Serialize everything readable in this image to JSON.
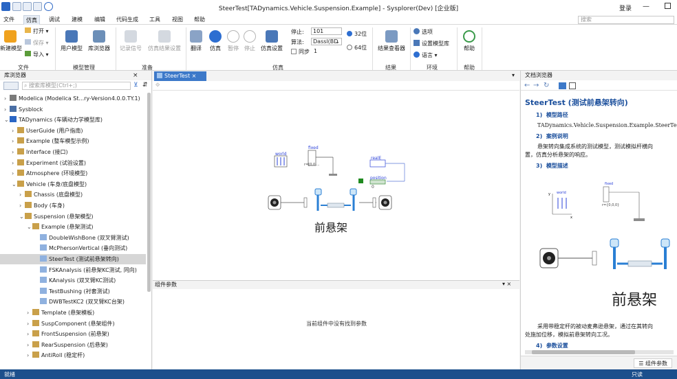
{
  "app": {
    "title": "SteerTest[TADynamics.Vehicle.Suspension.Example] - Sysplorer(Dev) [企业版]",
    "login": "登录"
  },
  "menu": [
    "文件",
    "仿真",
    "调试",
    "建模",
    "编辑",
    "代码生成",
    "工具",
    "视图",
    "帮助"
  ],
  "search": {
    "placeholder": "搜索"
  },
  "ribbon": {
    "new_model": "新建模型",
    "open": "打开",
    "save": "保存",
    "import": "导入",
    "user_model": "用户模型",
    "library_browser": "库浏览器",
    "record_signal": "记录信号",
    "sim_result_settings": "仿真结果设置",
    "translate": "翻译",
    "simulate": "仿真",
    "pause": "暂停",
    "stop": "停止",
    "sim_settings": "仿真设置",
    "stop_time_label": "停止:",
    "stop_time_value": "101",
    "algorithm_label": "算法:",
    "algorithm_value": "Dassl(BD",
    "sync_label": "同步",
    "sync_value": "1",
    "bit32": "32位",
    "bit64": "64位",
    "result_viewer": "结果查看器",
    "options": "选项",
    "set_model_lib": "设置模型库",
    "language": "语言",
    "help": "帮助",
    "groups": {
      "file": "文件",
      "model_mgmt": "模型管理",
      "prepare": "准备",
      "simulation": "仿真",
      "results": "结果",
      "env": "环境",
      "help": "帮助"
    }
  },
  "library": {
    "title": "库浏览器",
    "search_placeholder": "搜索库模型(Ctrl+;)",
    "items": [
      {
        "label": "Modelica (Modelica St...ry-Version4.0.0.TY.1)",
        "arrow": "›"
      },
      {
        "label": "Sysblock",
        "arrow": "›"
      },
      {
        "label": "TADynamics (车辆动力学模型库)",
        "arrow": "⌄"
      },
      {
        "label": "UserGuide (用户指南)",
        "arrow": "›"
      },
      {
        "label": "Example (整车模型示例)",
        "arrow": "›"
      },
      {
        "label": "Interface (接口)",
        "arrow": "›"
      },
      {
        "label": "Experiment (试验设置)",
        "arrow": "›"
      },
      {
        "label": "Atmosphere (环境模型)",
        "arrow": "›"
      },
      {
        "label": "Vehicle (车身/底盘模型)",
        "arrow": "⌄"
      },
      {
        "label": "Chassis (底盘模型)",
        "arrow": "›"
      },
      {
        "label": "Body (车身)",
        "arrow": "›"
      },
      {
        "label": "Suspension (悬架模型)",
        "arrow": "⌄"
      },
      {
        "label": "Example (悬架测试)",
        "arrow": "⌄"
      },
      {
        "label": "DoubleWishBone (双叉臂测试)",
        "arrow": ""
      },
      {
        "label": "McPhersonVertical (垂向测试)",
        "arrow": ""
      },
      {
        "label": "SteerTest (测试前悬架转向)",
        "arrow": ""
      },
      {
        "label": "FSKAnalysis (前悬架KC测试, 同向)",
        "arrow": ""
      },
      {
        "label": "KAnalysis (双叉臂KC测试)",
        "arrow": ""
      },
      {
        "label": "TestBushing (衬套测试)",
        "arrow": ""
      },
      {
        "label": "DWBTestKC2 (双叉臂KC台架)",
        "arrow": ""
      },
      {
        "label": "Template (悬架模板)",
        "arrow": "›"
      },
      {
        "label": "SuspComponent (悬架组件)",
        "arrow": "›"
      },
      {
        "label": "FrontSuspension (前悬架)",
        "arrow": "›"
      },
      {
        "label": "RearSuspension (后悬架)",
        "arrow": "›"
      },
      {
        "label": "AntiRoll (稳定杆)",
        "arrow": "›"
      }
    ]
  },
  "editor": {
    "tab": "SteerTest",
    "diagram": {
      "world": "world",
      "fixed": "fixed",
      "r_label": "r=[0,0,...",
      "real": "realE",
      "position": "position",
      "zero": "0",
      "caption": "前悬架"
    },
    "params": {
      "title": "组件参数",
      "empty": "当前组件中没有找到参数"
    }
  },
  "doc": {
    "title": "文档浏览器",
    "heading": "SteerTest (测试前悬架转向)",
    "s1": "1)",
    "s1_title": "模型路径",
    "path": "TADynamics.Vehicle.Suspension.Example.SteerTest",
    "s2": "2)",
    "s2_title": "案例说明",
    "desc": "悬架转向集成系统的测试模型，测试模拟杆横向",
    "desc2": "置，仿真分析悬架的响应。",
    "s3": "3)",
    "s3_title": "模型描述",
    "img_world": "world",
    "img_fixed": "fixed",
    "img_r": "r={0,0,0}",
    "img_y": "y",
    "img_x": "x",
    "caption": "前悬架",
    "desc3": "采用带稳定杆的被动麦弗逊悬架，通过在其转向",
    "desc4": "处施加位移，模拟前悬架转向工况。",
    "s4": "4)",
    "s4_title": "参数设置",
    "bottom_tab": "组件参数"
  },
  "status": {
    "left": "就绪",
    "right": "只读"
  }
}
